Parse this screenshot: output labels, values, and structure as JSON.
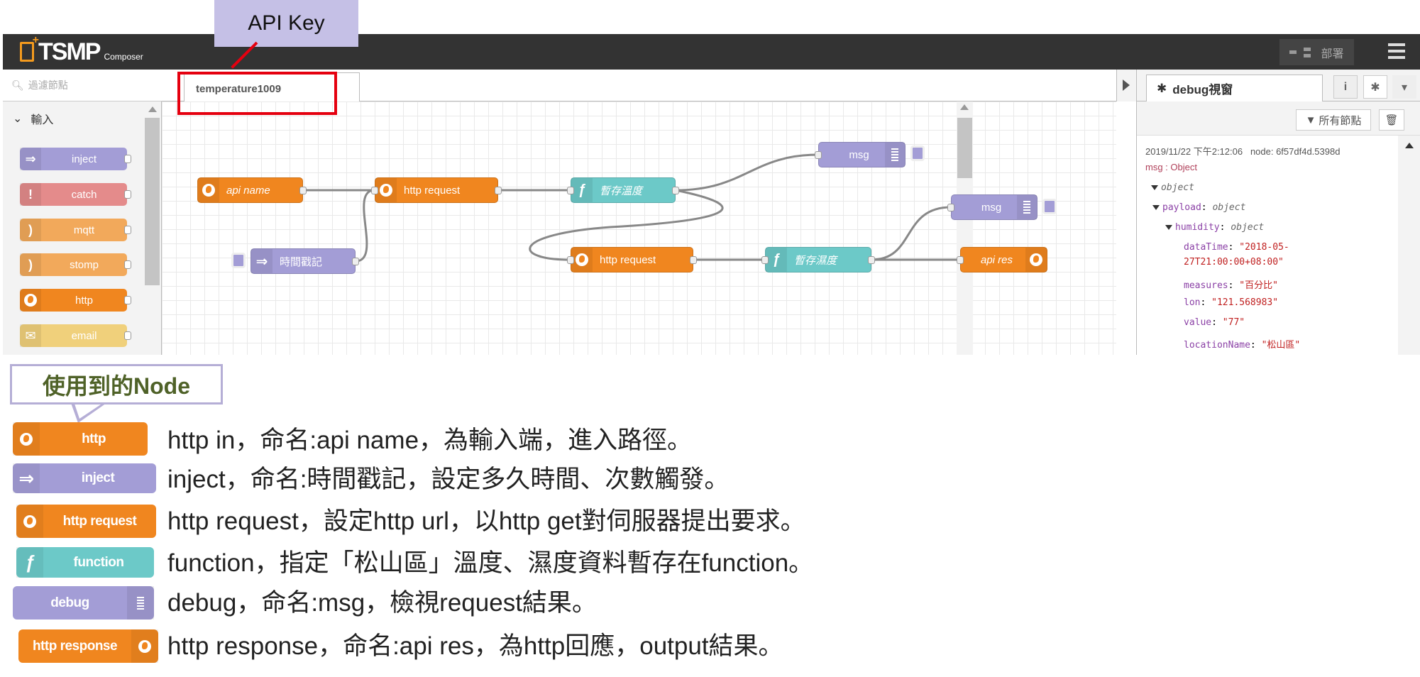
{
  "header": {
    "logo_text": "TSMP",
    "logo_sub": "Composer",
    "deploy_label": "部署"
  },
  "annotation": {
    "api_key": "API Key",
    "nodes_used": "使用到的Node"
  },
  "palette": {
    "search_placeholder": "過濾節點",
    "category": "輸入",
    "nodes": [
      "inject",
      "catch",
      "mqtt",
      "stomp",
      "http",
      "email"
    ]
  },
  "workspace": {
    "tab": "temperature1009"
  },
  "flow": {
    "nodes": {
      "api_name": "api name",
      "http_request_1": "http request",
      "func_temp": "暫存溫度",
      "debug_1": "msg",
      "inject": "時間戳記",
      "http_request_2": "http request",
      "func_humid": "暫存濕度",
      "debug_2": "msg",
      "api_res": "api res"
    }
  },
  "sidebar": {
    "tab": "debug視窗",
    "info_button": "i",
    "filter_label": "所有節點",
    "message": {
      "timestamp": "2019/11/22 下午2:12:06",
      "node": "node: 6f57df4d.5398d",
      "topic": "msg : Object",
      "tree": {
        "root": "object",
        "payload_key": "payload",
        "payload_type": "object",
        "humidity_key": "humidity",
        "humidity_type": "object",
        "fields": [
          {
            "key": "dataTime",
            "value": "\"2018-05-",
            "value2": "27T21:00:00+08:00\""
          },
          {
            "key": "measures",
            "value": "\"百分比\""
          },
          {
            "key": "lon",
            "value": "\"121.568983\""
          },
          {
            "key": "value",
            "value": "\"77\""
          },
          {
            "key": "locationName",
            "value": "\"松山區\""
          }
        ]
      }
    }
  },
  "legend": [
    {
      "node": "http",
      "text": "http in，命名:api name，為輸入端，進入路徑。"
    },
    {
      "node": "inject",
      "text": "inject，命名:時間戳記，設定多久時間、次數觸發。"
    },
    {
      "node": "http request",
      "text": "http request，設定http url，以http get對伺服器提出要求。"
    },
    {
      "node": "function",
      "text": "function，指定「松山區」溫度、濕度資料暫存在function。"
    },
    {
      "node": "debug",
      "text": "debug，命名:msg，檢視request結果。"
    },
    {
      "node": "http response",
      "text": "http response，命名:api res，為http回應，output結果。"
    }
  ],
  "colors": {
    "http": "#f0861f",
    "inject": "#a39dd6",
    "function": "#6cc9c8",
    "catch": "#e48b8b",
    "mqtt": "#f2a95b",
    "email": "#f0d07b",
    "highlight": "#e5000f"
  }
}
